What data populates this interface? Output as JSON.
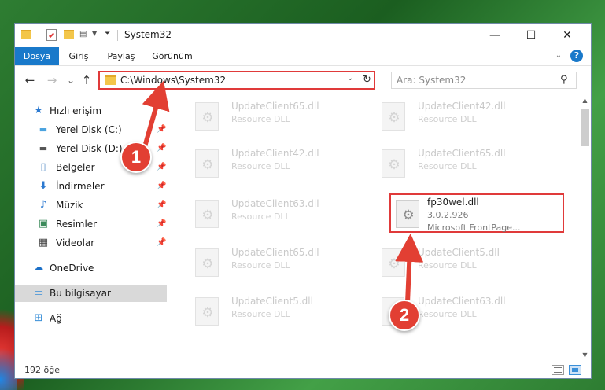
{
  "window": {
    "title": "System32",
    "controls": {
      "minimize": "—",
      "maximize": "☐",
      "close": "✕"
    }
  },
  "ribbon": {
    "tabs": [
      {
        "label": "Dosya",
        "active": true
      },
      {
        "label": "Giriş"
      },
      {
        "label": "Paylaş"
      },
      {
        "label": "Görünüm"
      }
    ],
    "help": "?"
  },
  "navigation": {
    "back": "←",
    "forward": "→",
    "recent": "⌄",
    "up": "↑",
    "address": "C:\\Windows\\System32",
    "search_placeholder": "Ara: System32"
  },
  "sidebar": {
    "items": [
      {
        "label": "Hızlı erişim",
        "icon": "star-icon"
      },
      {
        "label": "Yerel Disk (C:)",
        "icon": "drive-icon",
        "pinned": true
      },
      {
        "label": "Yerel Disk (D:)",
        "icon": "drive-icon",
        "pinned": true
      },
      {
        "label": "Belgeler",
        "icon": "documents-icon",
        "pinned": true
      },
      {
        "label": "İndirmeler",
        "icon": "download-icon",
        "pinned": true
      },
      {
        "label": "Müzik",
        "icon": "music-icon",
        "pinned": true
      },
      {
        "label": "Resimler",
        "icon": "pictures-icon",
        "pinned": true
      },
      {
        "label": "Videolar",
        "icon": "videos-icon",
        "pinned": true
      },
      {
        "label": "OneDrive",
        "icon": "cloud-icon"
      },
      {
        "label": "Bu bilgisayar",
        "icon": "computer-icon",
        "selected": true
      },
      {
        "label": "Ağ",
        "icon": "network-icon"
      }
    ]
  },
  "files": [
    {
      "name": "UpdateClient65.dll",
      "type": "Resource DLL"
    },
    {
      "name": "UpdateClient42.dll",
      "type": "Resource DLL"
    },
    {
      "name": "UpdateClient42.dll",
      "type": "Resource DLL"
    },
    {
      "name": "UpdateClient65.dll",
      "type": "Resource DLL"
    },
    {
      "name": "UpdateClient63.dll",
      "type": "Resource DLL"
    },
    {
      "name": "fp30wel.dll",
      "version": "3.0.2.926",
      "description": "Microsoft FrontPage...",
      "highlight": true
    },
    {
      "name": "UpdateClient65.dll",
      "type": "Resource DLL"
    },
    {
      "name": "UpdateClient5.dll",
      "type": "Resource DLL"
    },
    {
      "name": "UpdateClient5.dll",
      "type": "Resource DLL"
    },
    {
      "name": "UpdateClient63.dll",
      "type": "Resource DLL"
    }
  ],
  "status": {
    "count": "192 öğe"
  },
  "annotations": {
    "step1": "1",
    "step2": "2",
    "color": "#e23f33"
  }
}
